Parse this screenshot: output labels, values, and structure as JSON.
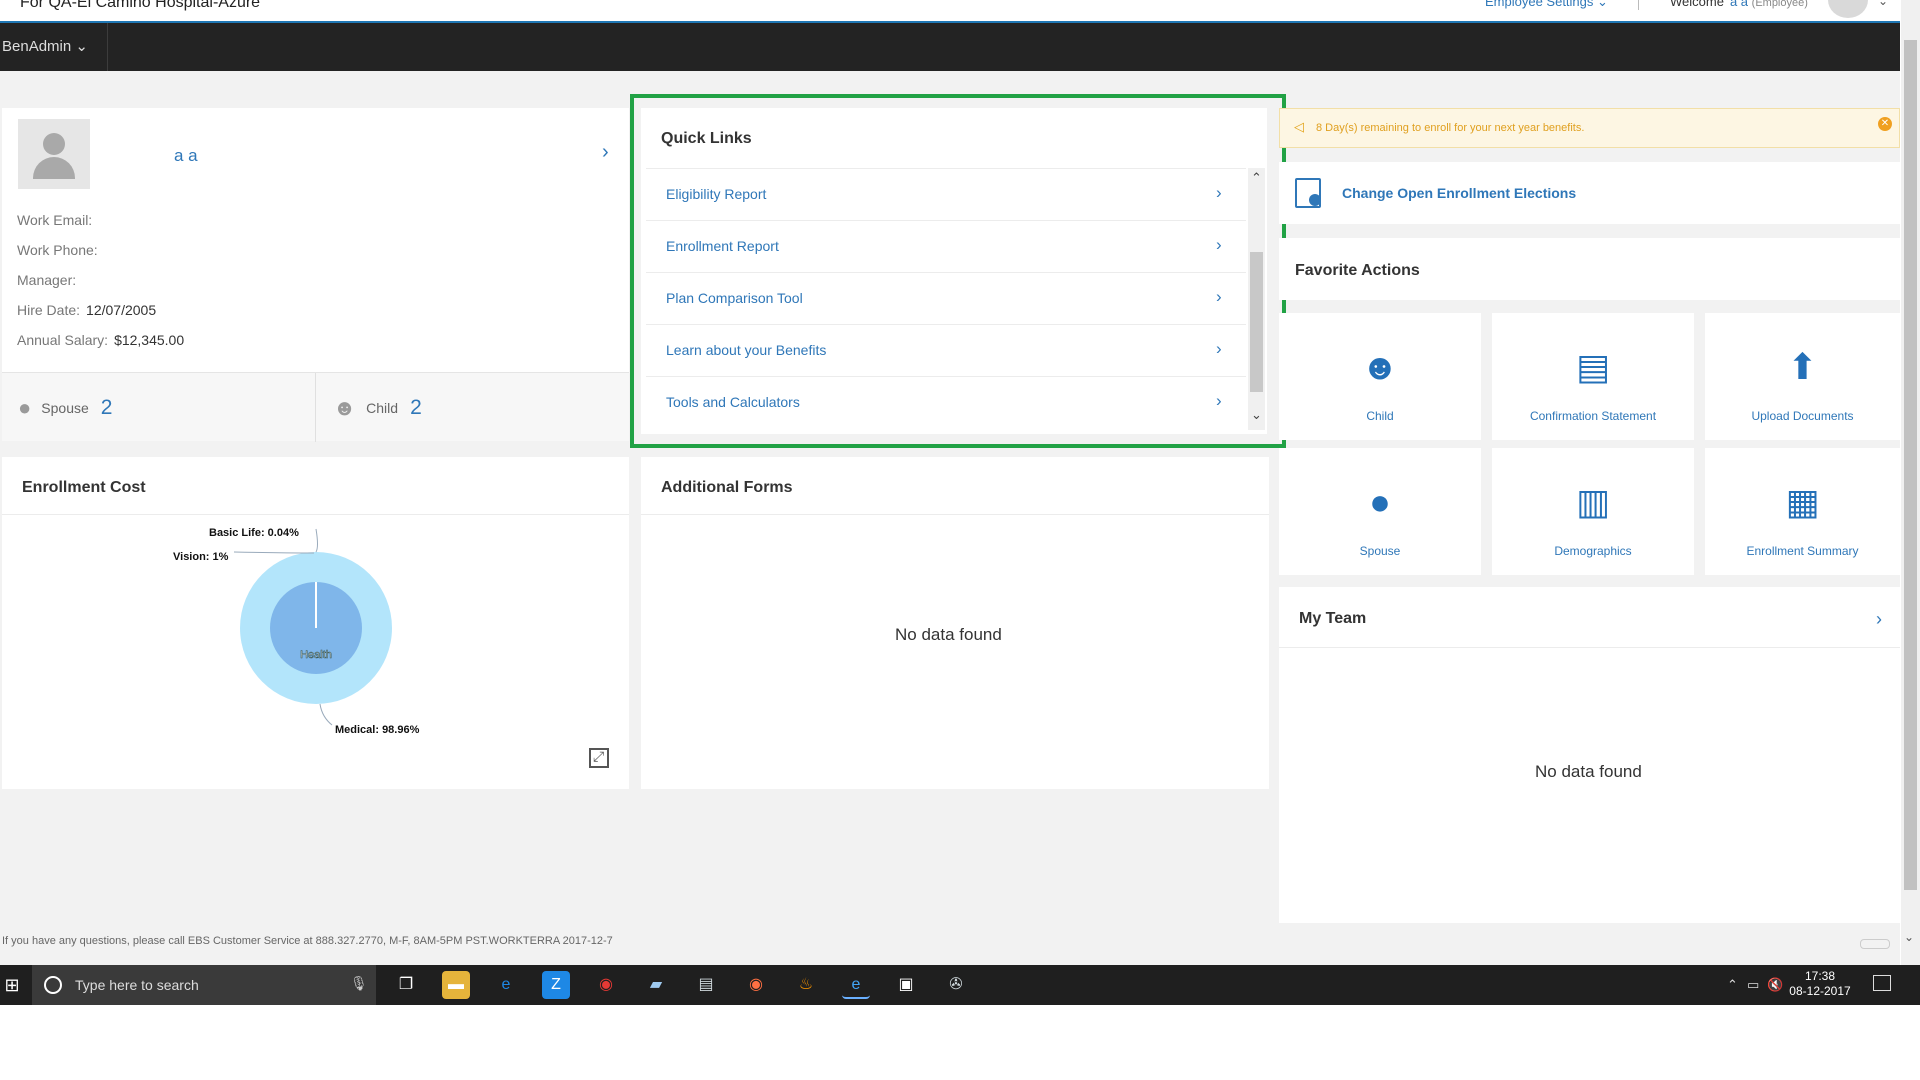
{
  "header": {
    "company": "For QA-El Camino Hospital-Azure",
    "employee_settings": "Employee Settings",
    "welcome": "Welcome",
    "user_name": "a a",
    "user_role": "(Employee)"
  },
  "nav": {
    "benadmin": "BenAdmin"
  },
  "profile": {
    "name": "a a",
    "work_email_label": "Work Email:",
    "work_email": "",
    "work_phone_label": "Work Phone:",
    "work_phone": "",
    "manager_label": "Manager:",
    "manager": "",
    "hire_date_label": "Hire Date:",
    "hire_date": "12/07/2005",
    "salary_label": "Annual Salary:",
    "salary": "$12,345.00",
    "spouse_label": "Spouse",
    "spouse_count": "2",
    "child_label": "Child",
    "child_count": "2"
  },
  "quick_links": {
    "title": "Quick Links",
    "items": [
      {
        "label": "Eligibility Report"
      },
      {
        "label": "Enrollment Report"
      },
      {
        "label": "Plan Comparison Tool"
      },
      {
        "label": "Learn about your Benefits"
      },
      {
        "label": "Tools and Calculators"
      }
    ]
  },
  "notice": {
    "text": "8 Day(s) remaining to enroll for your next year benefits."
  },
  "open_enrollment": {
    "label": "Change Open Enrollment Elections"
  },
  "favorites": {
    "title": "Favorite Actions",
    "tiles": [
      {
        "label": "Child",
        "icon": "child-icon"
      },
      {
        "label": "Confirmation Statement",
        "icon": "confirmation-statement-icon"
      },
      {
        "label": "Upload Documents",
        "icon": "upload-icon"
      },
      {
        "label": "Spouse",
        "icon": "spouse-icon"
      },
      {
        "label": "Demographics",
        "icon": "demographics-icon"
      },
      {
        "label": "Enrollment Summary",
        "icon": "enrollment-summary-icon"
      }
    ]
  },
  "enrollment_cost": {
    "title": "Enrollment Cost",
    "center_label": "Health"
  },
  "chart_data": {
    "type": "pie",
    "title": "Enrollment Cost",
    "inner": {
      "label": "Health",
      "value": 100
    },
    "slices": [
      {
        "label": "Basic Life: 0.04%",
        "value": 0.04
      },
      {
        "label": "Vision: 1%",
        "value": 1
      },
      {
        "label": "Medical: 98.96%",
        "value": 98.96
      }
    ],
    "colors": {
      "outer": "#b3e5fb",
      "inner": "#7fb6ea"
    }
  },
  "additional_forms": {
    "title": "Additional Forms",
    "empty": "No data found"
  },
  "my_team": {
    "title": "My Team",
    "empty": "No data found"
  },
  "footer": {
    "text": "If you have any questions, please call EBS Customer Service at 888.327.2770, M-F, 8AM-5PM PST.WORKTERRA 2017-12-7"
  },
  "taskbar": {
    "search_placeholder": "Type here to search",
    "time": "17:38",
    "date": "08-12-2017"
  },
  "colors": {
    "accent": "#2f77b8",
    "highlight": "#21a245",
    "nav": "#232323"
  }
}
